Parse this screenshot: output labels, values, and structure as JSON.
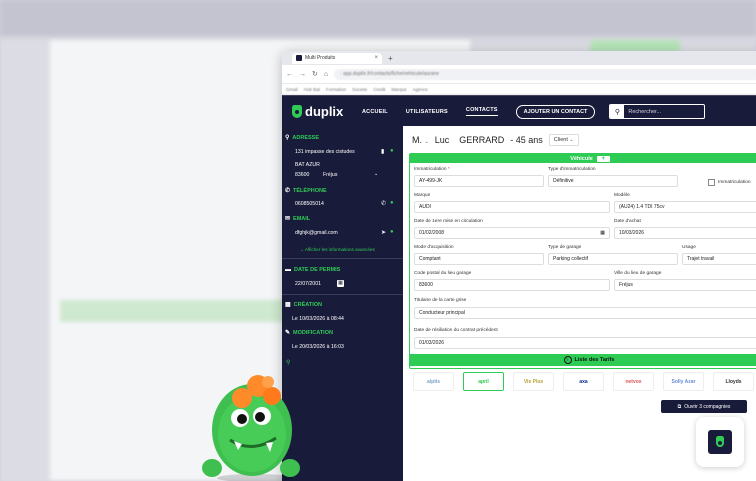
{
  "browser": {
    "tab_title": "Multi Produits",
    "new_tab": "+",
    "url": "· app.duplix.fr/contacts/fiche/vehicule/aurane",
    "bookmarks": [
      "Gmail",
      "Hub Bat",
      "Formation",
      "Societe",
      "Credit",
      "Marque",
      "Agence"
    ]
  },
  "header": {
    "logo": "duplix",
    "nav": [
      "ACCUEIL",
      "UTILISATEURS",
      "CONTACTS"
    ],
    "active_nav": "CONTACTS",
    "add_contact": "AJOUTER UN CONTACT",
    "search_placeholder": "Rechercher..."
  },
  "sidebar": {
    "adresse_label": "ADRESSE",
    "address_line1": "131 impasse des cistudes",
    "address_line2": "BAT AZUR",
    "postal_code": "83600",
    "city": "Fréjus",
    "telephone_label": "TÉLÉPHONE",
    "phone": "0608505014",
    "email_label": "EMAIL",
    "email": "dfghjk@gmail.com",
    "more_info": "Afficher les informations avancées",
    "permis_label": "DATE DE PERMIS",
    "permis_date": "22/07/2001",
    "creation_label": "CRÉATION",
    "creation_date": "Le 10/03/2026 à 08:44",
    "modification_label": "MODIFICATION",
    "modification_date": "Le 20/03/2026 à 16:03"
  },
  "contact": {
    "civility": "M.",
    "first_name": "Luc",
    "last_name": "GERRARD",
    "age": "- 45 ans",
    "type": "Client"
  },
  "vehicle": {
    "title": "Véhicule",
    "immat_label": "Immatriculation",
    "immat": "AY-499-JK",
    "type_immat_label": "Type d'immatriculation",
    "type_immat": "Définitive",
    "immat_checkbox": "Immatriculation",
    "marque_label": "Marque",
    "marque": "AUDI",
    "modele_label": "Modèle",
    "modele": "(AU24) 1.4 TDI 75cv",
    "mise_circ_label": "Date de 1ere mise en circulation",
    "mise_circ": "01/02/2008",
    "achat_label": "Date d'achat",
    "achat": "10/03/2026",
    "acquisition_label": "Mode d'acquisition",
    "acquisition": "Comptant",
    "garage_label": "Type de garage",
    "garage": "Parking collectif",
    "usage_label": "Usage",
    "usage": "Trajet travail",
    "cp_garage_label": "Code postal du lieu garage",
    "cp_garage": "83600",
    "ville_garage_label": "Ville du lieu de garage",
    "ville_garage": "Fréjus",
    "titulaire_label": "Titulaire de la carte grise",
    "titulaire": "Conducteur principal",
    "resiliation_label": "Date de résiliation du contrat précédent",
    "resiliation": "01/03/2026"
  },
  "tarifs": {
    "label": "Liste des Tarifs",
    "insurers": [
      "alptis",
      "april",
      "Vie Plus",
      "axa",
      "netvox",
      "Solly Azar",
      "Lloyds"
    ],
    "open_button": "Ouvrir 3 compagnies"
  },
  "colors": {
    "navy": "#191b3a",
    "green": "#2ecc55"
  }
}
